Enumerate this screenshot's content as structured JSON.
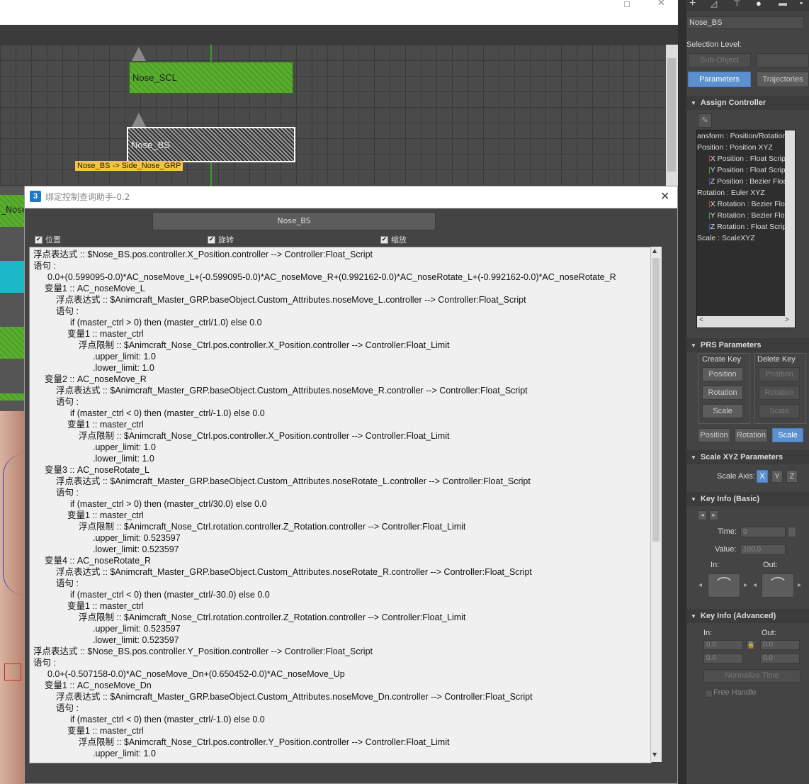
{
  "schematic": {
    "nodes": [
      {
        "label": "Nose_SCL"
      },
      {
        "label": "Nose_BS"
      }
    ],
    "tooltip": "Nose_BS -> Side_Nose_GRP",
    "left_fragment": "_Nose"
  },
  "dialog": {
    "icon": "3",
    "title": "绑定控制查询助手-0.2",
    "close": "✕",
    "button_label": "Nose_BS",
    "checkboxes": [
      {
        "label": "位置",
        "checked": true
      },
      {
        "label": "旋转",
        "checked": true
      },
      {
        "label": "缩放",
        "checked": true
      }
    ],
    "lines": [
      {
        "indent": 0,
        "text": "浮点表达式 :: $Nose_BS.pos.controller.X_Position.controller --> Controller:Float_Script"
      },
      {
        "indent": 0,
        "text": "语句 :"
      },
      {
        "indent": 20,
        "text": "0.0+(0.599095-0.0)*AC_noseMove_L+(-0.599095-0.0)*AC_noseMove_R+(0.992162-0.0)*AC_noseRotate_L+(-0.992162-0.0)*AC_noseRotate_R"
      },
      {
        "indent": 16,
        "text": "变量1 :: AC_noseMove_L"
      },
      {
        "indent": 32,
        "text": "浮点表达式 :: $Animcraft_Master_GRP.baseObject.Custom_Attributes.noseMove_L.controller --> Controller:Float_Script"
      },
      {
        "indent": 32,
        "text": "语句 :"
      },
      {
        "indent": 52,
        "text": "if (master_ctrl > 0) then (master_ctrl/1.0) else 0.0"
      },
      {
        "indent": 48,
        "text": "变量1 :: master_ctrl"
      },
      {
        "indent": 64,
        "text": "浮点限制 :: $Animcraft_Nose_Ctrl.pos.controller.X_Position.controller --> Controller:Float_Limit"
      },
      {
        "indent": 84,
        "text": ".upper_limit: 1.0"
      },
      {
        "indent": 84,
        "text": ".lower_limit: 1.0"
      },
      {
        "indent": 16,
        "text": "变量2 :: AC_noseMove_R"
      },
      {
        "indent": 32,
        "text": "浮点表达式 :: $Animcraft_Master_GRP.baseObject.Custom_Attributes.noseMove_R.controller --> Controller:Float_Script"
      },
      {
        "indent": 32,
        "text": "语句 :"
      },
      {
        "indent": 52,
        "text": "if (master_ctrl < 0) then (master_ctrl/-1.0) else 0.0"
      },
      {
        "indent": 48,
        "text": "变量1 :: master_ctrl"
      },
      {
        "indent": 64,
        "text": "浮点限制 :: $Animcraft_Nose_Ctrl.pos.controller.X_Position.controller --> Controller:Float_Limit"
      },
      {
        "indent": 84,
        "text": ".upper_limit: 1.0"
      },
      {
        "indent": 84,
        "text": ".lower_limit: 1.0"
      },
      {
        "indent": 16,
        "text": "变量3 :: AC_noseRotate_L"
      },
      {
        "indent": 32,
        "text": "浮点表达式 :: $Animcraft_Master_GRP.baseObject.Custom_Attributes.noseRotate_L.controller --> Controller:Float_Script"
      },
      {
        "indent": 32,
        "text": "语句 :"
      },
      {
        "indent": 52,
        "text": "if (master_ctrl > 0) then (master_ctrl/30.0) else 0.0"
      },
      {
        "indent": 48,
        "text": "变量1 :: master_ctrl"
      },
      {
        "indent": 64,
        "text": "浮点限制 :: $Animcraft_Nose_Ctrl.rotation.controller.Z_Rotation.controller --> Controller:Float_Limit"
      },
      {
        "indent": 84,
        "text": ".upper_limit: 0.523597"
      },
      {
        "indent": 84,
        "text": ".lower_limit: 0.523597"
      },
      {
        "indent": 16,
        "text": "变量4 :: AC_noseRotate_R"
      },
      {
        "indent": 32,
        "text": "浮点表达式 :: $Animcraft_Master_GRP.baseObject.Custom_Attributes.noseRotate_R.controller --> Controller:Float_Script"
      },
      {
        "indent": 32,
        "text": "语句 :"
      },
      {
        "indent": 52,
        "text": "if (master_ctrl < 0) then (master_ctrl/-30.0) else 0.0"
      },
      {
        "indent": 48,
        "text": "变量1 :: master_ctrl"
      },
      {
        "indent": 64,
        "text": "浮点限制 :: $Animcraft_Nose_Ctrl.rotation.controller.Z_Rotation.controller --> Controller:Float_Limit"
      },
      {
        "indent": 84,
        "text": ".upper_limit: 0.523597"
      },
      {
        "indent": 84,
        "text": ".lower_limit: 0.523597"
      },
      {
        "indent": 0,
        "text": "浮点表达式 :: $Nose_BS.pos.controller.Y_Position.controller --> Controller:Float_Script"
      },
      {
        "indent": 0,
        "text": "语句 :"
      },
      {
        "indent": 20,
        "text": "0.0+(-0.507158-0.0)*AC_noseMove_Dn+(0.650452-0.0)*AC_noseMove_Up"
      },
      {
        "indent": 16,
        "text": "变量1 :: AC_noseMove_Dn"
      },
      {
        "indent": 32,
        "text": "浮点表达式 :: $Animcraft_Master_GRP.baseObject.Custom_Attributes.noseMove_Dn.controller --> Controller:Float_Script"
      },
      {
        "indent": 32,
        "text": "语句 :"
      },
      {
        "indent": 52,
        "text": "if (master_ctrl < 0) then (master_ctrl/-1.0) else 0.0"
      },
      {
        "indent": 48,
        "text": "变量1 :: master_ctrl"
      },
      {
        "indent": 64,
        "text": "浮点限制 :: $Animcraft_Nose_Ctrl.pos.controller.Y_Position.controller --> Controller:Float_Limit"
      },
      {
        "indent": 84,
        "text": ".upper_limit: 1.0"
      }
    ]
  },
  "panel": {
    "object_name": "Nose_BS",
    "selection_level": "Selection Level:",
    "sub_object": "Sub-Object",
    "tab_parameters": "Parameters",
    "tab_trajectories": "Trajectories",
    "assign_controller": "Assign Controller",
    "tree": [
      "ansform : Position/Rotation/S",
      "Position : Position XYZ",
      "X Position : Float Script",
      "Y Position : Float Script",
      "Z Position : Bezier Float",
      "Rotation : Euler XYZ",
      "X Rotation : Bezier Float",
      "Y Rotation : Bezier Float",
      "Z Rotation : Float Script",
      "Scale : ScaleXYZ"
    ],
    "prs_parameters": "PRS Parameters",
    "create_key": "Create Key",
    "delete_key": "Delete Key",
    "position": "Position",
    "rotation": "Rotation",
    "scale": "Scale",
    "scale_xyz_parameters": "Scale XYZ Parameters",
    "scale_axis": "Scale Axis:",
    "axis_x": "X",
    "axis_y": "Y",
    "axis_z": "Z",
    "key_info_basic": "Key Info (Basic)",
    "time_label": "Time:",
    "time_value": "0",
    "value_label": "Value:",
    "value_value": "100.0",
    "in_label": "In:",
    "out_label": "Out:",
    "key_info_advanced": "Key Info (Advanced)",
    "adv_in_label": "In:",
    "adv_out_label": "Out:",
    "adv_val_1": "0.0",
    "adv_val_2": "0.0",
    "adv_val_3": "0.0",
    "adv_val_4": "0.0",
    "adv_val_5": "0.0",
    "normalize_time": "Normalize Time",
    "free_handle": "Free Handle"
  }
}
